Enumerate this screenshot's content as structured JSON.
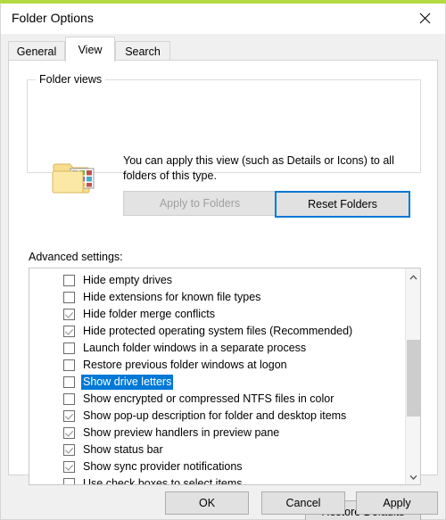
{
  "window": {
    "title": "Folder Options",
    "close_icon": "close-icon",
    "accent_color": "#b5d943"
  },
  "tabs": [
    {
      "label": "General",
      "active": false
    },
    {
      "label": "View",
      "active": true
    },
    {
      "label": "Search",
      "active": false
    }
  ],
  "folder_views": {
    "group_title": "Folder views",
    "icon": "folder-views-icon",
    "description": "You can apply this view (such as Details or Icons) to all folders of this type.",
    "apply_to_folders_label": "Apply to Folders",
    "apply_to_folders_disabled": true,
    "reset_folders_label": "Reset Folders",
    "reset_folders_focused": true
  },
  "advanced": {
    "label": "Advanced settings:",
    "items": [
      {
        "label": "Hide empty drives",
        "checked": false,
        "selected": false
      },
      {
        "label": "Hide extensions for known file types",
        "checked": false,
        "selected": false
      },
      {
        "label": "Hide folder merge conflicts",
        "checked": true,
        "selected": false
      },
      {
        "label": "Hide protected operating system files (Recommended)",
        "checked": true,
        "selected": false
      },
      {
        "label": "Launch folder windows in a separate process",
        "checked": false,
        "selected": false
      },
      {
        "label": "Restore previous folder windows at logon",
        "checked": false,
        "selected": false
      },
      {
        "label": "Show drive letters",
        "checked": false,
        "selected": true
      },
      {
        "label": "Show encrypted or compressed NTFS files in color",
        "checked": false,
        "selected": false
      },
      {
        "label": "Show pop-up description for folder and desktop items",
        "checked": true,
        "selected": false
      },
      {
        "label": "Show preview handlers in preview pane",
        "checked": true,
        "selected": false
      },
      {
        "label": "Show status bar",
        "checked": true,
        "selected": false
      },
      {
        "label": "Show sync provider notifications",
        "checked": true,
        "selected": false
      },
      {
        "label": "Use check boxes to select items",
        "checked": false,
        "selected": false
      }
    ],
    "scrollbar": {
      "up_arrow_icon": "chevron-up-icon",
      "down_arrow_icon": "chevron-down-icon"
    },
    "restore_defaults_label": "Restore Defaults"
  },
  "footer": {
    "ok_label": "OK",
    "cancel_label": "Cancel",
    "apply_label": "Apply"
  },
  "colors": {
    "selection_blue": "#0078d7",
    "focus_blue": "#0078d7",
    "accent_green": "#b5d943"
  }
}
